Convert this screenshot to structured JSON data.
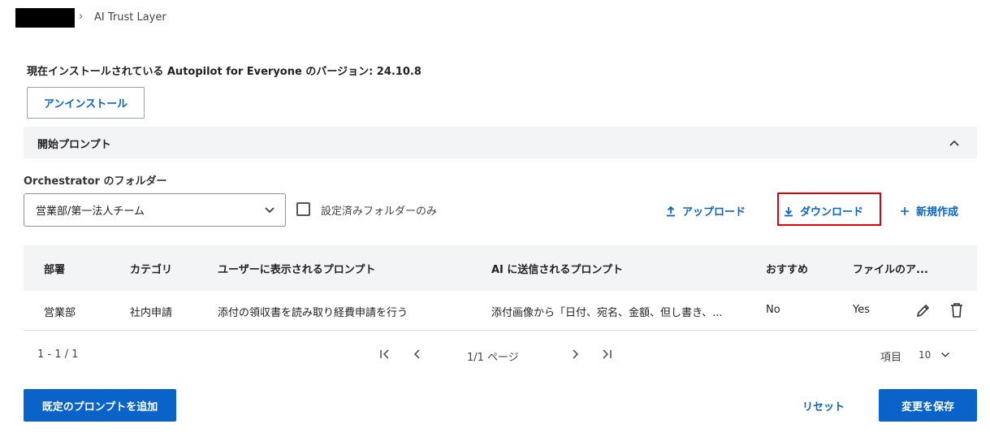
{
  "breadcrumb": {
    "separator": "›",
    "current": "AI Trust Layer"
  },
  "version_text": "現在インストールされている Autopilot for Everyone のバージョン: 24.10.8",
  "uninstall_button": "アンインストール",
  "section": {
    "title": "開始プロンプト",
    "collapse_icon": "chevron-up-icon"
  },
  "folder": {
    "label": "Orchestrator のフォルダー",
    "selected": "営業部/第一法人チーム",
    "configured_only_label": "設定済みフォルダーのみ"
  },
  "actions": {
    "upload": "アップロード",
    "download": "ダウンロード",
    "create_new": "新規作成"
  },
  "table": {
    "columns": [
      "部署",
      "カテゴリ",
      "ユーザーに表示されるプロンプト",
      "AI に送信されるプロンプト",
      "おすすめ",
      "ファイルのア..."
    ],
    "rows": [
      {
        "department": "営業部",
        "category": "社内申請",
        "user_prompt": "添付の領収書を読み取り経費申請を行う",
        "ai_prompt": "添付画像から「日付、宛名、金額、但し書き、...",
        "recommended": "No",
        "file_attach": "Yes"
      }
    ]
  },
  "pagination": {
    "range": "1 - 1 / 1",
    "page": "1/1 ページ",
    "items_label": "項目",
    "page_size": "10"
  },
  "footer": {
    "add_default": "既定のプロンプトを追加",
    "reset": "リセット",
    "save": "変更を保存"
  },
  "colors": {
    "accent": "#0a63c9",
    "highlight": "#e0000b"
  }
}
